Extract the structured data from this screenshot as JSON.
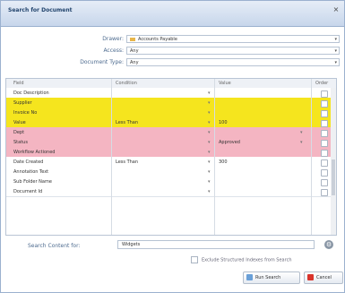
{
  "dialog": {
    "title": "Search for Document"
  },
  "filters": {
    "drawer_label": "Drawer:",
    "drawer_value": "Accounts Payable",
    "access_label": "Access:",
    "access_value": "Any",
    "doctype_label": "Document Type:",
    "doctype_value": "Any"
  },
  "grid": {
    "columns": [
      "Field",
      "Condition",
      "Value",
      "Order"
    ],
    "rows": [
      {
        "field": "Doc Description",
        "condition": "",
        "value": "",
        "bg": "#ffffff",
        "value_dropdown": false
      },
      {
        "field": "Supplier",
        "condition": "",
        "value": "",
        "bg": "#f5e51e",
        "value_dropdown": false
      },
      {
        "field": "Invoice No",
        "condition": "",
        "value": "",
        "bg": "#f5e51e",
        "value_dropdown": false
      },
      {
        "field": "Value",
        "condition": "Less Than",
        "value": "100",
        "bg": "#f5e51e",
        "value_dropdown": false
      },
      {
        "field": "Dept",
        "condition": "",
        "value": "",
        "bg": "#f4b5c2",
        "value_dropdown": true
      },
      {
        "field": "Status",
        "condition": "",
        "value": "Approved",
        "bg": "#f4b5c2",
        "value_dropdown": true
      },
      {
        "field": "Workflow Actioned",
        "condition": "",
        "value": "",
        "bg": "#f4b5c2",
        "value_dropdown": false
      },
      {
        "field": "Date Created",
        "condition": "Less Than",
        "value": "300",
        "bg": "#ffffff",
        "value_dropdown": false
      },
      {
        "field": "Annotation Text",
        "condition": "",
        "value": "",
        "bg": "#ffffff",
        "value_dropdown": false
      },
      {
        "field": "Sub Folder Name",
        "condition": "",
        "value": "",
        "bg": "#ffffff",
        "value_dropdown": false
      },
      {
        "field": "Document Id",
        "condition": "",
        "value": "",
        "bg": "#ffffff",
        "value_dropdown": false
      }
    ]
  },
  "search": {
    "label": "Search Content for:",
    "value": "Widgets"
  },
  "exclude_label": "Exclude Structured Indexes from Search",
  "buttons": {
    "run_search": "Run Search",
    "cancel": "Cancel"
  },
  "colors": {
    "yellow_row": "#f5e51e",
    "pink_row": "#f4b5c2",
    "accent": "#4d6b8f"
  }
}
